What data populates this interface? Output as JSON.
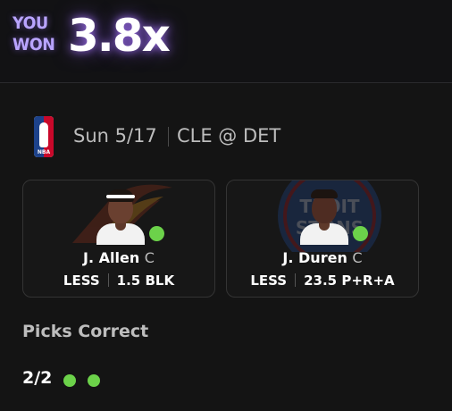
{
  "header": {
    "you_won_line1": "YOU",
    "you_won_line2": "WON",
    "multiplier": "3.8x"
  },
  "game": {
    "league_logo": "nba-logo",
    "league_logo_text": "NBA",
    "date": "Sun 5/17",
    "matchup": "CLE @ DET"
  },
  "picks": [
    {
      "name": "J. Allen",
      "position": "C",
      "direction": "LESS",
      "line": "1.5",
      "stat": "BLK",
      "team_logo": "cavaliers-logo",
      "status": "correct"
    },
    {
      "name": "J. Duren",
      "position": "C",
      "direction": "LESS",
      "line": "23.5",
      "stat": "P+R+A",
      "team_logo": "pistons-logo",
      "status": "correct"
    }
  ],
  "summary": {
    "title": "Picks Correct",
    "score": "2/2",
    "results": [
      "correct",
      "correct"
    ]
  },
  "colors": {
    "background": "#141414",
    "accent_purple": "#b9a4ff",
    "correct_green": "#6cd24a",
    "card_border": "#343434"
  }
}
